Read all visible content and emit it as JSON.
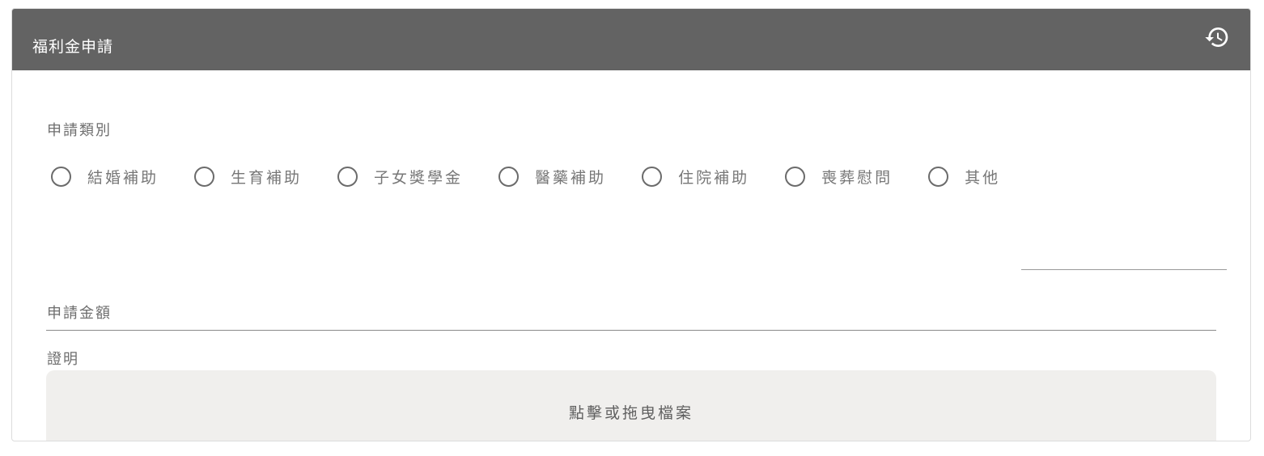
{
  "header": {
    "title": "福利金申請",
    "history_icon": "history-icon"
  },
  "form": {
    "category": {
      "label": "申請類別",
      "options": [
        "結婚補助",
        "生育補助",
        "子女獎學金",
        "醫藥補助",
        "住院補助",
        "喪葬慰問",
        "其他"
      ],
      "other_value": ""
    },
    "amount": {
      "label": "申請金額"
    },
    "proof": {
      "label": "證明",
      "dropzone_text": "點擊或拖曳檔案"
    }
  },
  "colors": {
    "header_bg": "#636363",
    "dropzone_bg": "#f0efed",
    "text_muted": "#6e6e6e"
  }
}
